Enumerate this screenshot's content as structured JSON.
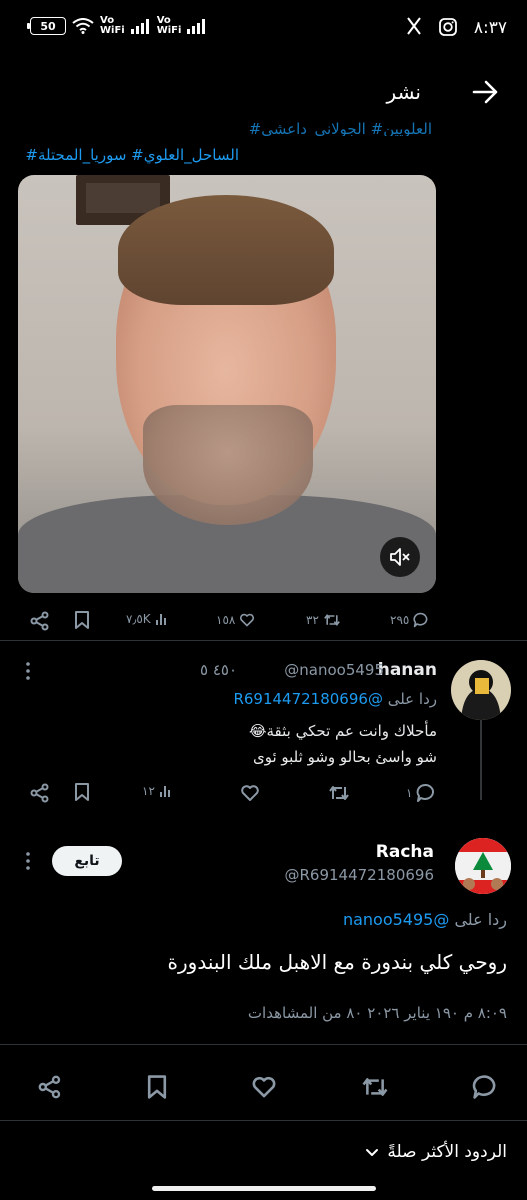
{
  "status_bar": {
    "time": "٨:٣٧",
    "battery": "50",
    "net1": [
      "Vo",
      "WiFi"
    ],
    "net2": [
      "Vo",
      "WiFi"
    ]
  },
  "header": {
    "title": "نشر"
  },
  "parent_tweet": {
    "hashtags_line1": "العلويين# الجولاني_داعشي#",
    "hashtags_line2": "الساحل_العلوي# سوريا_المحتلة#",
    "stats": {
      "replies": "٢٩٥",
      "reposts": "٣٢",
      "likes": "١٥٨",
      "views": "٧٫٥K"
    }
  },
  "reply": {
    "name": "hanan",
    "handle": "@nanoo5495",
    "time": "٤٥٠ ٥",
    "replying_prefix": "ردا على",
    "replying_to": "@R6914472180696",
    "text_line1": "مأحلاك وانت عم تحكي بثقة😂",
    "text_line2": "شو واسئ بحالو وشو ثلبو ئوى",
    "stats": {
      "replies": "١",
      "views": "١٢"
    }
  },
  "main_tweet": {
    "name": "Racha",
    "handle": "@R6914472180696",
    "follow_label": "تابع",
    "replying_prefix": "ردا على",
    "replying_to": "@nanoo5495",
    "text": "روحي كلي بندورة  مع الاهبل ملك البندورة",
    "meta": "٨:٠٩ م ١٩٠ يناير ٢٠٢٦ ٨٠ من المشاهدات"
  },
  "replies_sort": {
    "label": "الردود الأكثر صلةً"
  },
  "colors": {
    "accent": "#1d9bf0",
    "muted": "#8b98a5",
    "background": "#000000"
  }
}
